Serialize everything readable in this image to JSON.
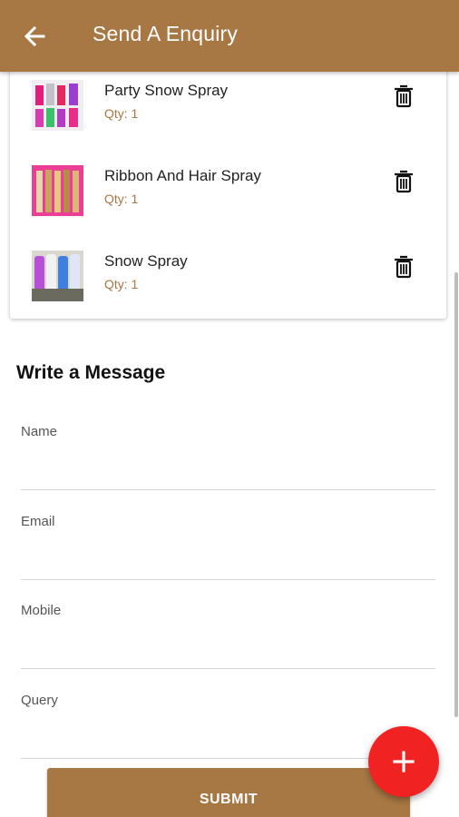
{
  "appbar": {
    "title": "Send A Enquiry",
    "color": "#a87844"
  },
  "cart": {
    "items": [
      {
        "name": "Party Snow Spray",
        "qty": "Qty: 1",
        "image": "party-snow-spray-photo"
      },
      {
        "name": "Ribbon And Hair Spray",
        "qty": "Qty: 1",
        "image": "ribbon-hair-spray-photo"
      },
      {
        "name": "Snow Spray",
        "qty": "Qty: 1",
        "image": "snow-spray-photo"
      }
    ]
  },
  "form": {
    "title": "Write a Message",
    "fields": [
      {
        "label": "Name",
        "value": ""
      },
      {
        "label": "Email",
        "value": ""
      },
      {
        "label": "Mobile",
        "value": ""
      },
      {
        "label": "Query",
        "value": ""
      }
    ],
    "submit_label": "SUBMIT"
  },
  "fab": {
    "icon": "plus-icon",
    "color": "#f02222"
  },
  "accent_colors": {
    "brand": "#a87844",
    "fab": "#f02222"
  }
}
